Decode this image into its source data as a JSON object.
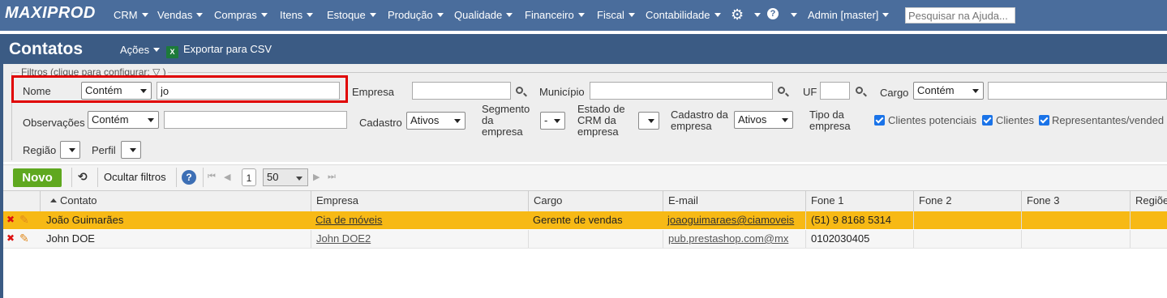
{
  "app": {
    "logo": "MAXIPROD",
    "menu": [
      "CRM",
      "Vendas",
      "Compras",
      "Itens",
      "Estoque",
      "Produção",
      "Qualidade",
      "Financeiro",
      "Fiscal",
      "Contabilidade"
    ],
    "user": "Admin [master]",
    "help_search_placeholder": "Pesquisar na Ajuda..."
  },
  "page": {
    "title": "Contatos",
    "actions_label": "Ações",
    "export_label": "Exportar para CSV"
  },
  "filters": {
    "legend": "Filtros (clique para configurar:",
    "nome_label": "Nome",
    "nome_mode": "Contém",
    "nome_value": "jo",
    "empresa_label": "Empresa",
    "empresa_value": "",
    "municipio_label": "Município",
    "municipio_value": "",
    "uf_label": "UF",
    "uf_value": "",
    "cargo_label": "Cargo",
    "cargo_mode": "Contém",
    "observacoes_label": "Observações",
    "observacoes_mode": "Contém",
    "cadastro_label": "Cadastro",
    "cadastro_value": "Ativos",
    "segmento_label": "Segmento da empresa",
    "segmento_value": "-",
    "estado_crm_label": "Estado de CRM da empresa",
    "estado_crm_value": "",
    "cadastro_empresa_label": "Cadastro da empresa",
    "cadastro_empresa_value": "Ativos",
    "tipo_empresa_label": "Tipo da empresa",
    "tipo_options": [
      "Clientes potenciais",
      "Clientes",
      "Representantes/vended"
    ],
    "regiao_label": "Região",
    "perfil_label": "Perfil"
  },
  "toolbar": {
    "novo_label": "Novo",
    "ocultar_label": "Ocultar filtros",
    "page": "1",
    "page_size": "50"
  },
  "grid": {
    "columns": [
      "Contato",
      "Empresa",
      "Cargo",
      "E-mail",
      "Fone 1",
      "Fone 2",
      "Fone 3",
      "Regiões"
    ],
    "rows": [
      {
        "contato": "João Guimarães",
        "empresa": "Cia de móveis",
        "cargo": "Gerente de vendas",
        "email": "joaoguimaraes@ciamoveis",
        "fone1": "(51) 9 8168 5314",
        "fone2": "",
        "fone3": ""
      },
      {
        "contato": "John DOE",
        "empresa": "John DOE2",
        "cargo": "",
        "email": "pub.prestashop.com@mx",
        "fone1": "0102030405",
        "fone2": "",
        "fone3": ""
      }
    ]
  },
  "colors": {
    "nav": "#4a6d9c",
    "titlebar": "#3b5b84",
    "selected_row": "#f7b915",
    "novo": "#5fa81f",
    "highlight": "#e00000"
  }
}
